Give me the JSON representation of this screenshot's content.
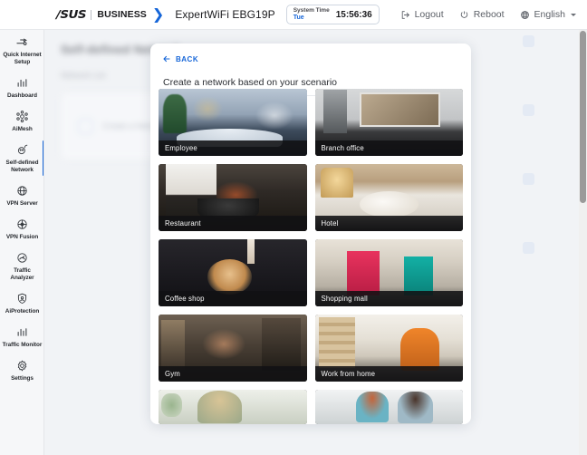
{
  "topbar": {
    "logo_text": "/SUS",
    "business_label": "BUSINESS",
    "chevron_icon": "chevron-right-icon",
    "model": "ExpertWiFi EBG19P",
    "system_time_label": "System Time",
    "system_time_day": "Tue",
    "system_time_clock": "15:56:36",
    "logout_label": "Logout",
    "reboot_label": "Reboot",
    "language_label": "English"
  },
  "sidebar": {
    "items": [
      {
        "label": "Quick Internet Setup",
        "icon": "quick-setup-icon",
        "active": false
      },
      {
        "label": "Dashboard",
        "icon": "dashboard-icon",
        "active": false
      },
      {
        "label": "AiMesh",
        "icon": "aimesh-icon",
        "active": false
      },
      {
        "label": "Self-defined Network",
        "icon": "self-defined-network-icon",
        "active": true
      },
      {
        "label": "VPN Server",
        "icon": "vpn-server-icon",
        "active": false
      },
      {
        "label": "VPN Fusion",
        "icon": "vpn-fusion-icon",
        "active": false
      },
      {
        "label": "Traffic Analyzer",
        "icon": "traffic-analyzer-icon",
        "active": false
      },
      {
        "label": "AiProtection",
        "icon": "aiprotection-icon",
        "active": false
      },
      {
        "label": "Traffic Monitor",
        "icon": "traffic-monitor-icon",
        "active": false
      },
      {
        "label": "Settings",
        "icon": "settings-icon",
        "active": false
      }
    ]
  },
  "background_page": {
    "title": "Self-defined Network",
    "subtitle": "Network List",
    "panel_text": "Create a Network"
  },
  "modal": {
    "back_label": "BACK",
    "back_icon": "arrow-left-icon",
    "title": "Create a network based on your scenario",
    "cards": [
      {
        "label": "Employee",
        "art": "art-employee",
        "clipped": false
      },
      {
        "label": "Branch office",
        "art": "art-branch",
        "clipped": false
      },
      {
        "label": "Restaurant",
        "art": "art-restaurant",
        "clipped": false
      },
      {
        "label": "Hotel",
        "art": "art-hotel",
        "clipped": false
      },
      {
        "label": "Coffee shop",
        "art": "art-coffee",
        "clipped": false
      },
      {
        "label": "Shopping mall",
        "art": "art-shopping",
        "clipped": false
      },
      {
        "label": "Gym",
        "art": "art-gym",
        "clipped": false
      },
      {
        "label": "Work from home",
        "art": "art-wfh",
        "clipped": false
      },
      {
        "label": "",
        "art": "art-student",
        "clipped": true
      },
      {
        "label": "",
        "art": "art-team",
        "clipped": true
      }
    ]
  },
  "colors": {
    "accent": "#1565d8",
    "topbar_bg": "#ffffff",
    "sidebar_bg": "#f6f7f9",
    "page_bg": "#f1f3f6",
    "caption_bg": "#111113"
  }
}
